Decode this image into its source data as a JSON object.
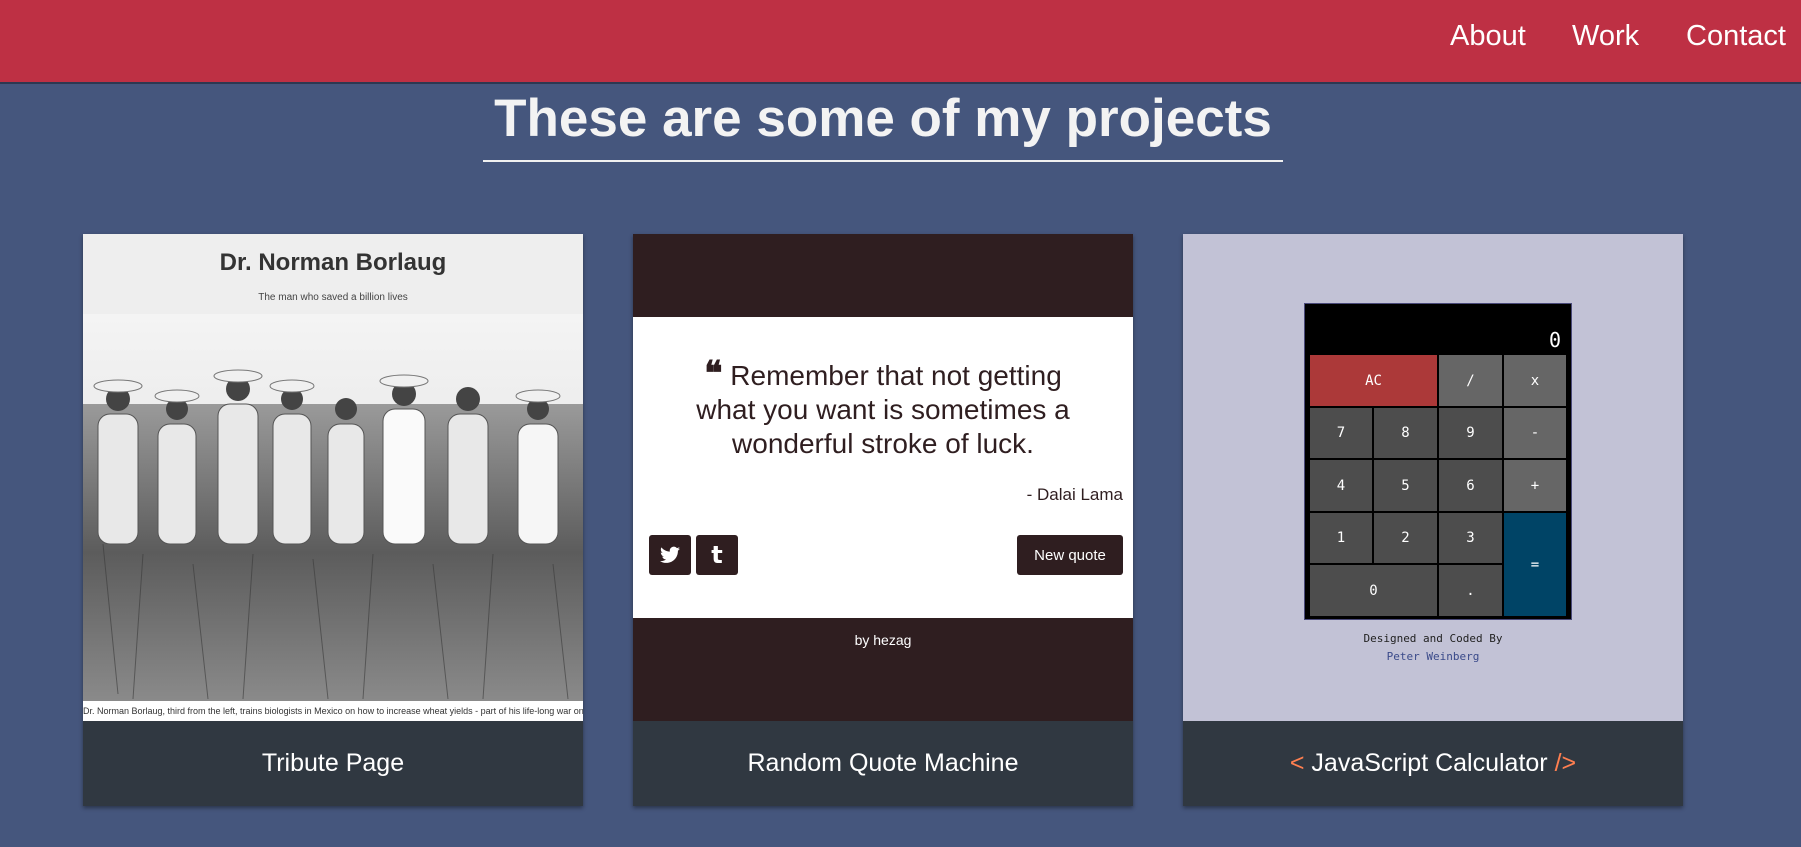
{
  "nav": {
    "items": [
      {
        "label": "About"
      },
      {
        "label": "Work"
      },
      {
        "label": "Contact"
      }
    ]
  },
  "heading": "These are some of my projects",
  "projects": [
    {
      "caption": "Tribute Page",
      "preview": {
        "title": "Dr. Norman Borlaug",
        "subtitle": "The man who saved a billion lives",
        "photo_caption": "Dr. Norman Borlaug, third from the left, trains biologists in Mexico on how to increase wheat yields - part of his life-long war on hunger."
      }
    },
    {
      "caption": "Random Quote Machine",
      "preview": {
        "quote": "Remember that not getting what you want is sometimes a wonderful stroke of luck.",
        "author": "- Dalai Lama",
        "twitter_icon": "twitter-icon",
        "tumblr_icon": "tumblr-icon",
        "new_quote_label": "New quote",
        "byline_prefix": "by",
        "byline_name": "hezag"
      }
    },
    {
      "caption_open": "<",
      "caption": "JavaScript Calculator",
      "caption_close": "/>",
      "preview": {
        "display": "0",
        "keys": [
          "AC",
          "/",
          "x",
          "7",
          "8",
          "9",
          "-",
          "4",
          "5",
          "6",
          "+",
          "1",
          "2",
          "3",
          "=",
          "0",
          "."
        ],
        "credit_line": "Designed and Coded By",
        "credit_name": "Peter Weinberg"
      }
    }
  ],
  "colors": {
    "nav": "#be3044",
    "background": "#45567d",
    "card_caption": "#303841",
    "accent": "#ff7f50"
  }
}
